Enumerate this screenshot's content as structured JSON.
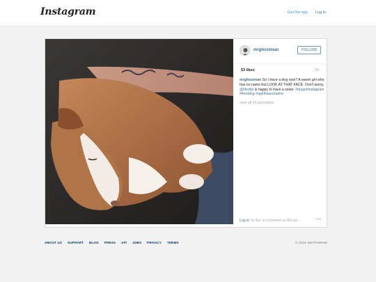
{
  "header": {
    "logo": "Instagram",
    "get_app": "Get the app",
    "login": "Log in"
  },
  "post": {
    "username": "mrghostman",
    "follow_label": "FOLLOW",
    "likes": "53 likes",
    "age": "2h",
    "caption": {
      "user": "mrghostman",
      "text_1": " So I have a dog now? A sweet girl who has no name but LOOK AT THAT FACE. Don't worry, ",
      "mention": "@lifeofpi",
      "text_2": " is happy to have a sister. ",
      "tags": "#dogsofinstagram #tireddog #agirlhasnoname"
    },
    "view_all": "view all 24 comments",
    "comment_login": "Log in",
    "comment_prompt": "to like or comment on this po...",
    "more": "•••"
  },
  "footer": {
    "links": [
      "ABOUT US",
      "SUPPORT",
      "BLOG",
      "PRESS",
      "API",
      "JOBS",
      "PRIVACY",
      "TERMS"
    ],
    "copyright": "© 2015 INSTAGRAM"
  },
  "colors": {
    "link_blue": "#3f729b",
    "app_blue": "#3897f0",
    "muted": "#a5a7aa",
    "background": "#f2f2f2"
  },
  "icons": [
    "instagram-logo",
    "more-options-icon",
    "user-avatar"
  ]
}
